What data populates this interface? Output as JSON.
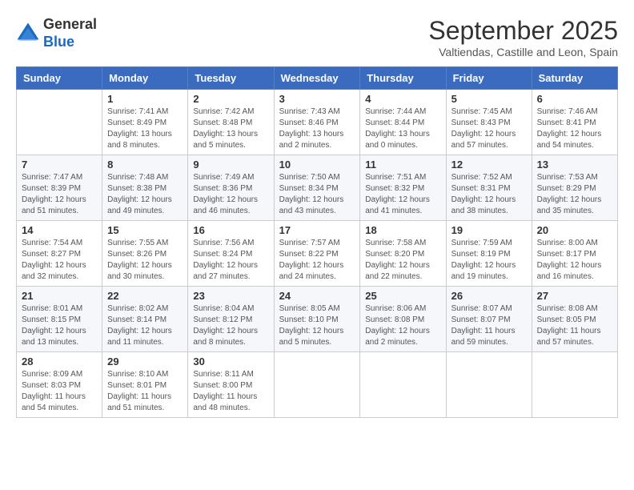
{
  "header": {
    "logo_general": "General",
    "logo_blue": "Blue",
    "month_title": "September 2025",
    "subtitle": "Valtiendas, Castille and Leon, Spain"
  },
  "days_of_week": [
    "Sunday",
    "Monday",
    "Tuesday",
    "Wednesday",
    "Thursday",
    "Friday",
    "Saturday"
  ],
  "weeks": [
    [
      {
        "day": "",
        "info": ""
      },
      {
        "day": "1",
        "info": "Sunrise: 7:41 AM\nSunset: 8:49 PM\nDaylight: 13 hours\nand 8 minutes."
      },
      {
        "day": "2",
        "info": "Sunrise: 7:42 AM\nSunset: 8:48 PM\nDaylight: 13 hours\nand 5 minutes."
      },
      {
        "day": "3",
        "info": "Sunrise: 7:43 AM\nSunset: 8:46 PM\nDaylight: 13 hours\nand 2 minutes."
      },
      {
        "day": "4",
        "info": "Sunrise: 7:44 AM\nSunset: 8:44 PM\nDaylight: 13 hours\nand 0 minutes."
      },
      {
        "day": "5",
        "info": "Sunrise: 7:45 AM\nSunset: 8:43 PM\nDaylight: 12 hours\nand 57 minutes."
      },
      {
        "day": "6",
        "info": "Sunrise: 7:46 AM\nSunset: 8:41 PM\nDaylight: 12 hours\nand 54 minutes."
      }
    ],
    [
      {
        "day": "7",
        "info": "Sunrise: 7:47 AM\nSunset: 8:39 PM\nDaylight: 12 hours\nand 51 minutes."
      },
      {
        "day": "8",
        "info": "Sunrise: 7:48 AM\nSunset: 8:38 PM\nDaylight: 12 hours\nand 49 minutes."
      },
      {
        "day": "9",
        "info": "Sunrise: 7:49 AM\nSunset: 8:36 PM\nDaylight: 12 hours\nand 46 minutes."
      },
      {
        "day": "10",
        "info": "Sunrise: 7:50 AM\nSunset: 8:34 PM\nDaylight: 12 hours\nand 43 minutes."
      },
      {
        "day": "11",
        "info": "Sunrise: 7:51 AM\nSunset: 8:32 PM\nDaylight: 12 hours\nand 41 minutes."
      },
      {
        "day": "12",
        "info": "Sunrise: 7:52 AM\nSunset: 8:31 PM\nDaylight: 12 hours\nand 38 minutes."
      },
      {
        "day": "13",
        "info": "Sunrise: 7:53 AM\nSunset: 8:29 PM\nDaylight: 12 hours\nand 35 minutes."
      }
    ],
    [
      {
        "day": "14",
        "info": "Sunrise: 7:54 AM\nSunset: 8:27 PM\nDaylight: 12 hours\nand 32 minutes."
      },
      {
        "day": "15",
        "info": "Sunrise: 7:55 AM\nSunset: 8:26 PM\nDaylight: 12 hours\nand 30 minutes."
      },
      {
        "day": "16",
        "info": "Sunrise: 7:56 AM\nSunset: 8:24 PM\nDaylight: 12 hours\nand 27 minutes."
      },
      {
        "day": "17",
        "info": "Sunrise: 7:57 AM\nSunset: 8:22 PM\nDaylight: 12 hours\nand 24 minutes."
      },
      {
        "day": "18",
        "info": "Sunrise: 7:58 AM\nSunset: 8:20 PM\nDaylight: 12 hours\nand 22 minutes."
      },
      {
        "day": "19",
        "info": "Sunrise: 7:59 AM\nSunset: 8:19 PM\nDaylight: 12 hours\nand 19 minutes."
      },
      {
        "day": "20",
        "info": "Sunrise: 8:00 AM\nSunset: 8:17 PM\nDaylight: 12 hours\nand 16 minutes."
      }
    ],
    [
      {
        "day": "21",
        "info": "Sunrise: 8:01 AM\nSunset: 8:15 PM\nDaylight: 12 hours\nand 13 minutes."
      },
      {
        "day": "22",
        "info": "Sunrise: 8:02 AM\nSunset: 8:14 PM\nDaylight: 12 hours\nand 11 minutes."
      },
      {
        "day": "23",
        "info": "Sunrise: 8:04 AM\nSunset: 8:12 PM\nDaylight: 12 hours\nand 8 minutes."
      },
      {
        "day": "24",
        "info": "Sunrise: 8:05 AM\nSunset: 8:10 PM\nDaylight: 12 hours\nand 5 minutes."
      },
      {
        "day": "25",
        "info": "Sunrise: 8:06 AM\nSunset: 8:08 PM\nDaylight: 12 hours\nand 2 minutes."
      },
      {
        "day": "26",
        "info": "Sunrise: 8:07 AM\nSunset: 8:07 PM\nDaylight: 11 hours\nand 59 minutes."
      },
      {
        "day": "27",
        "info": "Sunrise: 8:08 AM\nSunset: 8:05 PM\nDaylight: 11 hours\nand 57 minutes."
      }
    ],
    [
      {
        "day": "28",
        "info": "Sunrise: 8:09 AM\nSunset: 8:03 PM\nDaylight: 11 hours\nand 54 minutes."
      },
      {
        "day": "29",
        "info": "Sunrise: 8:10 AM\nSunset: 8:01 PM\nDaylight: 11 hours\nand 51 minutes."
      },
      {
        "day": "30",
        "info": "Sunrise: 8:11 AM\nSunset: 8:00 PM\nDaylight: 11 hours\nand 48 minutes."
      },
      {
        "day": "",
        "info": ""
      },
      {
        "day": "",
        "info": ""
      },
      {
        "day": "",
        "info": ""
      },
      {
        "day": "",
        "info": ""
      }
    ]
  ]
}
